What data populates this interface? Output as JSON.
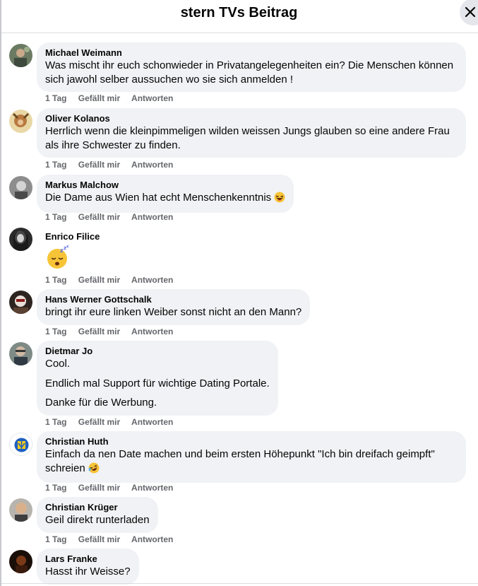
{
  "header": {
    "title": "stern TVs Beitrag"
  },
  "icons": {
    "close": "close-icon"
  },
  "comments": [
    {
      "author": "Michael Weimann",
      "text": [
        "Was mischt ihr euch schonwieder in Privatangelegenheiten ein? Die Menschen können sich jawohl selber aussuchen wo sie sich anmelden !"
      ],
      "time": "1 Tag",
      "like": "Gefällt mir",
      "reply": "Antworten"
    },
    {
      "author": "Oliver Kolanos",
      "text": [
        "Herrlich wenn die kleinpimmeligen wilden weissen Jungs glauben so eine andere Frau als ihre Schwester zu finden."
      ],
      "time": "1 Tag",
      "like": "Gefällt mir",
      "reply": "Antworten"
    },
    {
      "author": "Markus Malchow",
      "text": [
        "Die Dame aus Wien hat echt Menschenkenntnis"
      ],
      "emoji": "laughing-emoji",
      "time": "1 Tag",
      "like": "Gefällt mir",
      "reply": "Antworten"
    },
    {
      "author": "Enrico Filice",
      "text": [],
      "emoji": "sleeping-emoji",
      "time": "1 Tag",
      "like": "Gefällt mir",
      "reply": "Antworten"
    },
    {
      "author": "Hans Werner Gottschalk",
      "text": [
        "bringt ihr eure linken Weiber sonst nicht an den Mann?"
      ],
      "time": "1 Tag",
      "like": "Gefällt mir",
      "reply": "Antworten"
    },
    {
      "author": "Dietmar Jo",
      "text": [
        "Cool.",
        "Endlich mal Support für wichtige Dating Portale.",
        "Danke für die Werbung."
      ],
      "time": "1 Tag",
      "like": "Gefällt mir",
      "reply": "Antworten"
    },
    {
      "author": "Christian Huth",
      "text": [
        "Einfach da nen Date machen und beim ersten Höhepunkt \"Ich bin dreifach geimpft\" schreien"
      ],
      "emoji": "rofl-emoji",
      "time": "1 Tag",
      "like": "Gefällt mir",
      "reply": "Antworten"
    },
    {
      "author": "Christian Krüger",
      "text": [
        "Geil direkt runterladen"
      ],
      "time": "1 Tag",
      "like": "Gefällt mir",
      "reply": "Antworten"
    },
    {
      "author": "Lars Franke",
      "text": [
        "Hasst ihr Weisse?"
      ]
    }
  ],
  "colors": {
    "bubble": "#f0f2f5",
    "meta": "#65676b",
    "text": "#050505"
  }
}
